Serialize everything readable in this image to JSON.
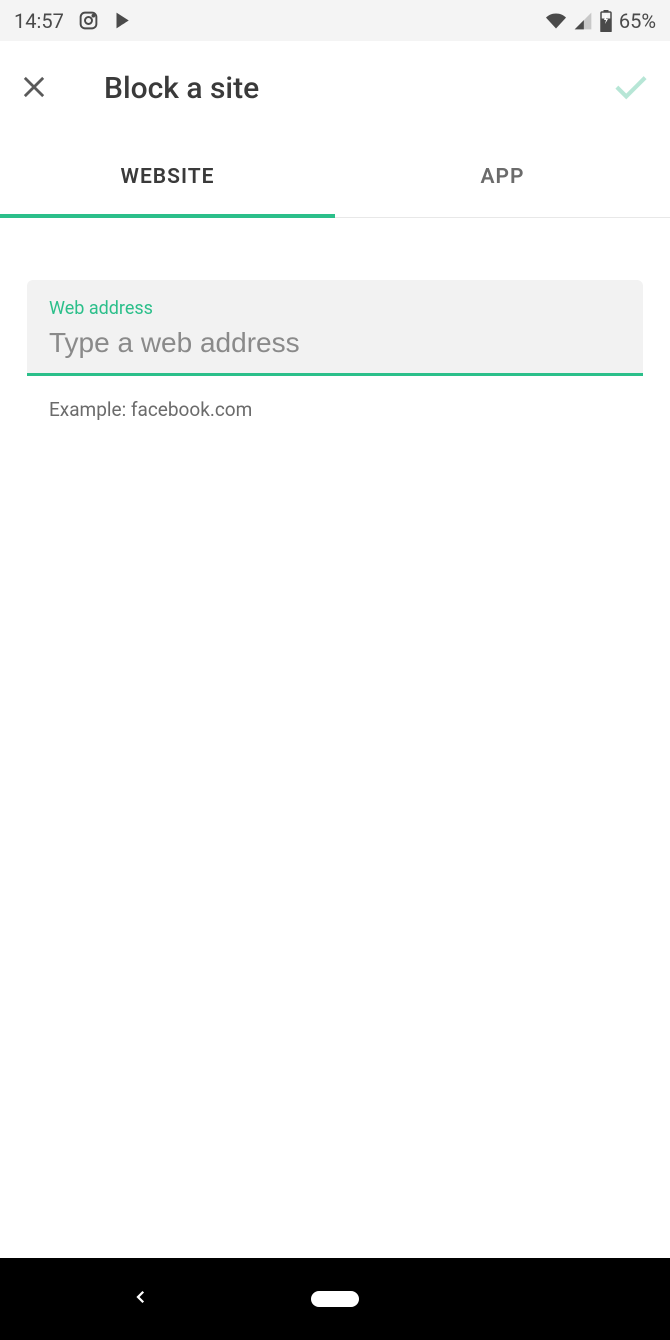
{
  "status": {
    "time": "14:57",
    "battery": "65%"
  },
  "header": {
    "title": "Block a site"
  },
  "tabs": {
    "website": "WEBSITE",
    "app": "APP"
  },
  "form": {
    "label": "Web address",
    "placeholder": "Type a web address",
    "value": "",
    "helper": "Example: facebook.com"
  },
  "colors": {
    "accent": "#2bbf8a"
  }
}
